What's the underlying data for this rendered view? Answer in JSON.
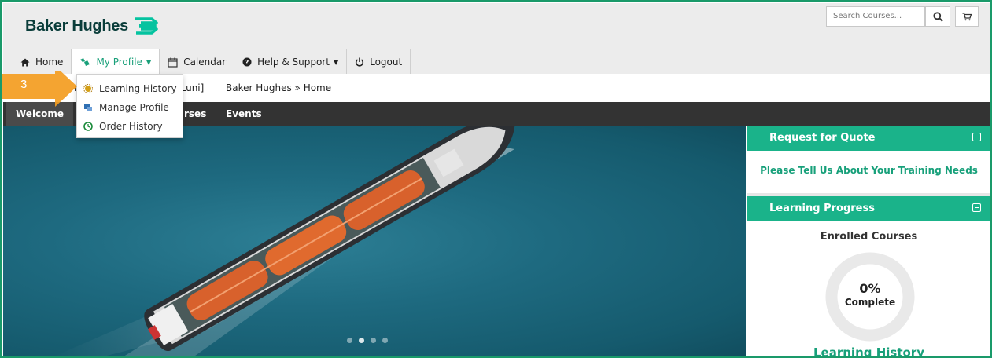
{
  "brand": {
    "name": "Baker Hughes",
    "accent": "#1ab38a",
    "logo_color": "#0a3d3a"
  },
  "search": {
    "placeholder": "Search Courses..."
  },
  "nav": {
    "items": [
      {
        "label": "Home",
        "icon": "home-icon"
      },
      {
        "label": "My Profile",
        "icon": "profile-icon",
        "active": true
      },
      {
        "label": "Calendar",
        "icon": "calendar-icon"
      },
      {
        "label": "Help & Support",
        "icon": "question-circle-icon"
      },
      {
        "label": "Logout",
        "icon": "power-icon"
      }
    ]
  },
  "profile_menu": {
    "items": [
      {
        "label": "Learning History",
        "icon": "badge-icon"
      },
      {
        "label": "Manage Profile",
        "icon": "profile-card-icon"
      },
      {
        "label": "Order History",
        "icon": "clock-icon"
      }
    ]
  },
  "strip": {
    "user_fragment": "n",
    "user_suffix": "Luni]",
    "breadcrumb": "Baker Hughes » Home"
  },
  "tabs": {
    "welcome": "Welcome",
    "courses_fragment": "rses",
    "events": "Events"
  },
  "annotation": {
    "step": "3"
  },
  "sidebar": {
    "quote": {
      "title": "Request for Quote",
      "link": "Please Tell Us About Your Training Needs"
    },
    "progress": {
      "title": "Learning Progress",
      "enrolled": "Enrolled Courses",
      "percent_label": "0%",
      "complete_label": "Complete",
      "percent": 0,
      "history_link": "Learning History"
    }
  },
  "carousel": {
    "slide_count": 4,
    "active_slide": 2
  }
}
